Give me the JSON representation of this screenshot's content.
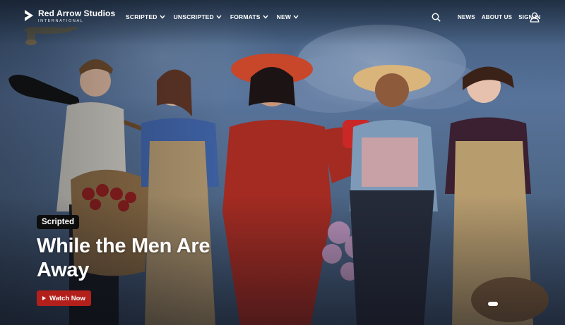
{
  "brand": {
    "name": "Red Arrow Studios",
    "sub": "INTERNATIONAL"
  },
  "nav": {
    "left": [
      {
        "label": "SCRIPTED",
        "icon": "chevron-down-icon"
      },
      {
        "label": "UNSCRIPTED",
        "icon": "chevron-down-icon"
      },
      {
        "label": "FORMATS",
        "icon": "chevron-down-icon"
      },
      {
        "label": "NEW",
        "icon": "chevron-down-icon"
      }
    ],
    "right": [
      {
        "label": "NEWS"
      },
      {
        "label": "ABOUT US"
      },
      {
        "label": "SIGN IN"
      }
    ],
    "search_icon": "search-icon",
    "user_icon": "user-icon"
  },
  "hero": {
    "badge": "Scripted",
    "title": "While the Men Are Away",
    "cta": "Watch Now",
    "cta_icon": "play-icon",
    "accent": "#b3201c"
  },
  "carousel": {
    "active_dot": 1
  }
}
